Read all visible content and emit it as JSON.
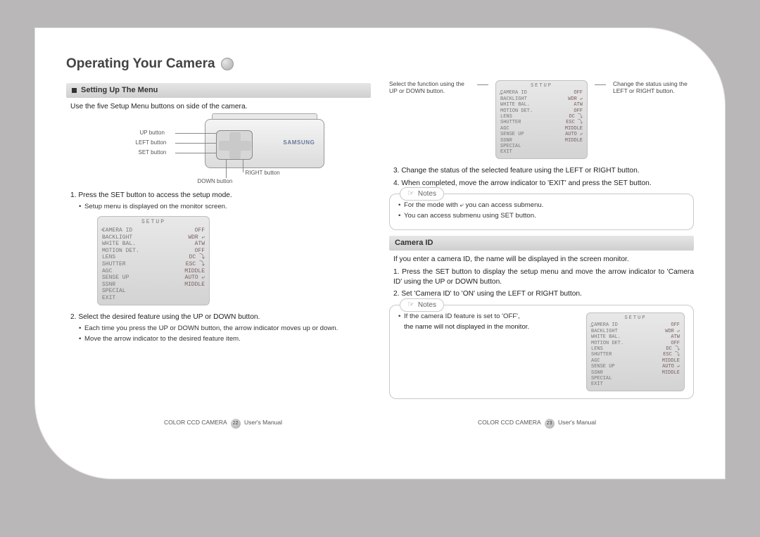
{
  "title": "Operating Your Camera",
  "section_setup": "Setting Up The Menu",
  "intro": "Use the five Setup Menu buttons on side of the camera.",
  "diagram_labels": {
    "up": "UP button",
    "left": "LEFT button",
    "set": "SET button",
    "down": "DOWN button",
    "right": "RIGHT button"
  },
  "brand": "SAMSUNG",
  "step1": "1. Press the SET button to access the setup mode.",
  "step1_sub1": "Setup menu is displayed on the monitor screen.",
  "osd_title": "SETUP",
  "osd_rows": [
    {
      "k": "CAMERA ID",
      "v": "OFF"
    },
    {
      "k": "BACKLIGHT",
      "v": "WDR ⤶"
    },
    {
      "k": "WHITE BAL.",
      "v": "ATW"
    },
    {
      "k": "MOTION DET.",
      "v": "OFF"
    },
    {
      "k": "LENS",
      "v": "DC ⤵"
    },
    {
      "k": "SHUTTER",
      "v": "ESC ⤵"
    },
    {
      "k": "AGC",
      "v": "MIDDLE"
    },
    {
      "k": "SENSE UP",
      "v": "AUTO ⤶"
    },
    {
      "k": "SSNR",
      "v": "MIDDLE"
    },
    {
      "k": "SPECIAL",
      "v": ""
    },
    {
      "k": "EXIT",
      "v": ""
    }
  ],
  "step2": "2. Select the desired feature using the UP or DOWN button.",
  "step2_sub1": "Each time you press the UP or DOWN button, the arrow indicator moves up or down.",
  "step2_sub2": "Move the arrow indicator to the desired feature item.",
  "callout_left": "Select the function using the UP or DOWN button.",
  "callout_right": "Change the status using the LEFT or RIGHT button.",
  "step3": "3. Change the status of the selected feature using the LEFT or RIGHT button.",
  "step4": "4. When completed, move the arrow indicator to 'EXIT' and press the SET button.",
  "notes_label": "Notes",
  "notes1_a": "For the mode with ⤶ you can access submenu.",
  "notes1_b": "You can access submenu using SET button.",
  "section_camera_id": "Camera ID",
  "cid_intro": "If you enter a camera ID, the name will be displayed in the screen monitor.",
  "cid_step1": "1. Press the SET button to display the setup menu and move the arrow indicator to 'Camera ID' using the UP or DOWN button.",
  "cid_step2": "2. Set 'Camera ID' to 'ON' using the LEFT or RIGHT button.",
  "notes2_a": "If the camera ID feature is set to 'OFF',",
  "notes2_b": "the name will not displayed in the monitor.",
  "footer_product": "COLOR CCD CAMERA",
  "footer_doc": "User's Manual",
  "page_left": "22",
  "page_right": "23"
}
